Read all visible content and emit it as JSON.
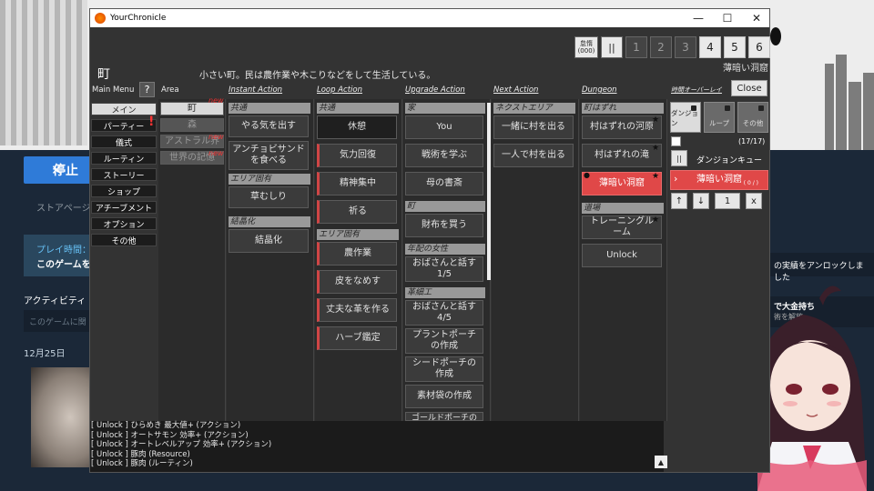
{
  "window": {
    "title": "YourChronicle"
  },
  "header": {
    "place": "町",
    "description": "小さい町。民は農作業や木こりなどをして生活している。",
    "corner_location": "薄暗い洞窟"
  },
  "speed": {
    "lazy": "怠惰\n(000)",
    "pause": "||",
    "levels": [
      "1",
      "2",
      "3",
      "4",
      "5",
      "6"
    ],
    "active_from": 4
  },
  "columns": {
    "main_menu": "Main Menu",
    "area": "Area",
    "instant": "Instant Action",
    "loop": "Loop Action",
    "upgrade": "Upgrade Action",
    "next": "Next Action",
    "dungeon": "Dungeon",
    "queue": "時間オーバーレイ"
  },
  "main_menu": {
    "help": "?",
    "items": [
      "メイン",
      "パーティー",
      "儀式",
      "ルーティン",
      "ストーリー",
      "ショップ",
      "アチーブメント",
      "オプション",
      "その他"
    ]
  },
  "area": {
    "items": [
      "町",
      "森",
      "アストラル界",
      "世界の記憶"
    ],
    "new_label": "new"
  },
  "instant": {
    "sec_common": "共通",
    "common": [
      "やる気を出す",
      "アンチョビサンドを食べる"
    ],
    "sec_area": "エリア固有",
    "area": [
      "草むしり"
    ],
    "sec_crystal": "結晶化",
    "crystal": [
      "結晶化"
    ]
  },
  "loop": {
    "sec_common": "共通",
    "common": [
      "休憩",
      "気力回復",
      "精神集中",
      "祈る"
    ],
    "sec_area": "エリア固有",
    "area": [
      "農作業",
      "皮をなめす",
      "丈夫な革を作る",
      "ハーブ鑑定"
    ]
  },
  "upgrade": {
    "sec_home": "家",
    "home": [
      "You",
      "戦術を学ぶ",
      "母の書斎"
    ],
    "sec_town": "町",
    "town": [
      "財布を買う"
    ],
    "sec_woman": "年配の女性",
    "woman": [
      "おばさんと話す\n1/5"
    ],
    "sec_leather": "革細工",
    "leather": [
      "おばさんと話す\n4/5",
      "プラントポーチの作成",
      "シードポーチの作成",
      "素材袋の作成",
      "ゴールドポーチの"
    ]
  },
  "next": {
    "sec": "ネクストエリア",
    "items": [
      "一緒に村を出る",
      "一人で村を出る"
    ]
  },
  "dungeon": {
    "sec_edge": "町はずれ",
    "edge": [
      "村はずれの河原",
      "村はずれの滝",
      "薄暗い洞窟"
    ],
    "sec_dojo": "道場",
    "dojo": [
      "トレーニングルーム",
      "Unlock"
    ]
  },
  "queue": {
    "close": "Close",
    "tabs": [
      "ダンジョン",
      "ループ",
      "その他"
    ],
    "count": "(17/17)",
    "pause": "||",
    "label": "ダンジョンキュー",
    "current": "薄暗い洞窟",
    "current_sub": "( 0 / )",
    "arrow": "›",
    "up": "↑",
    "down": "↓",
    "qty": "1",
    "remove": "x"
  },
  "log": {
    "lines": [
      "[ Unlock ] ひらめき 最大値+ (アクション)",
      "[ Unlock ] オートサモン 効率+ (アクション)",
      "[ Unlock ] オートレベルアップ 効率+ (アクション)",
      "[ Unlock ] 豚肉 (Resource)",
      "[ Unlock ] 豚肉 (ルーティン)"
    ],
    "up": "▲"
  },
  "steam": {
    "button": "停止",
    "button_icon": "✕",
    "tab": "ストアページ",
    "play_label": "プレイ時間：",
    "play_value": "このゲームを",
    "activity": "アクティビティ",
    "activity_placeholder": "このゲームに関",
    "date": "12月25日",
    "achievement": "の実績をアンロックしました",
    "ach2": "で大金持ち",
    "ach2_sub": "術を解放"
  },
  "colors": {
    "accent_red": "#e04848",
    "steam_blue": "#2f7bd8",
    "panel": "#333333"
  }
}
